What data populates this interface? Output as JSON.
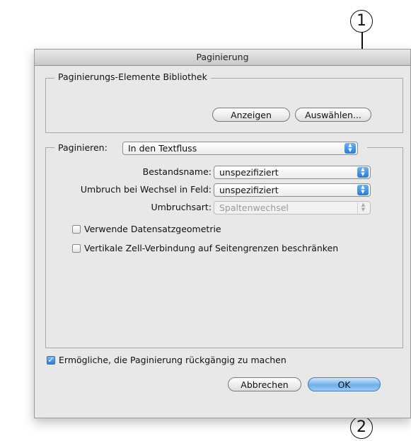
{
  "callouts": {
    "one": "1",
    "two": "2"
  },
  "dialog": {
    "title": "Paginierung",
    "library": {
      "legend": "Paginierungs-Elemente Bibliothek",
      "show_button": "Anzeigen",
      "choose_button": "Auswählen..."
    },
    "paginate": {
      "label": "Paginieren:",
      "value": "In den Textfluss",
      "inventory_label": "Bestandsname:",
      "inventory_value": "unspezifiziert",
      "break_label": "Umbruch bei Wechsel in Feld:",
      "break_value": "unspezifiziert",
      "break_type_label": "Umbruchsart:",
      "break_type_value": "Spaltenwechsel",
      "use_record_geometry": "Verwende Datensatzgeometrie",
      "limit_vertical_merge": "Vertikale Zell-Verbindung auf Seitengrenzen beschränken"
    },
    "undo_checkbox": "Ermögliche, die Paginierung rückgängig zu machen",
    "cancel_button": "Abbrechen",
    "ok_button": "OK",
    "colors": {
      "accent": "#2f80d6",
      "panel": "#e8e8e8"
    }
  }
}
